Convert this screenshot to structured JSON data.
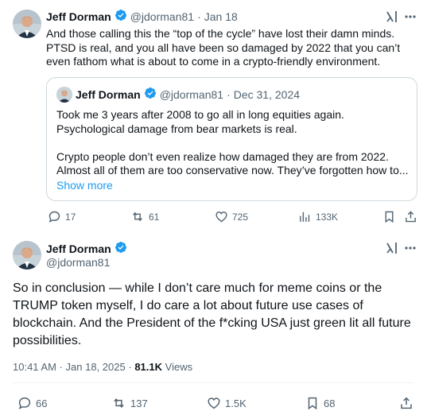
{
  "tweet1": {
    "author_name": "Jeff Dorman",
    "author_handle": "@jdorman81",
    "separator": "·",
    "date": "Jan 18",
    "text_lines": [
      "And those calling this the “top of the cycle” have lost their damn minds.",
      "PTSD is real, and you all have been so damaged by 2022 that you can’t",
      "even fathom what is about to come in a crypto-friendly environment."
    ],
    "quote": {
      "author_name": "Jeff Dorman",
      "author_handle": "@jdorman81",
      "separator": "·",
      "date": "Dec 31, 2024",
      "text_lines": [
        "Took me 3 years after 2008 to go all in long equities again.",
        "Psychological damage from bear markets is real.",
        "",
        "Crypto people don’t even realize how damaged they are from 2022.",
        "Almost all of them are too conservative now. They’ve forgotten how to..."
      ],
      "show_more": "Show more"
    },
    "stats": {
      "replies": "17",
      "reposts": "61",
      "likes": "725",
      "views": "133K"
    }
  },
  "tweet2": {
    "author_name": "Jeff Dorman",
    "author_handle": "@jdorman81",
    "text_lines": [
      "So in conclusion — while I don’t care much for meme coins or the",
      "TRUMP token myself, I do care a lot about future use cases of",
      "blockchain. And the President of the f*cking USA just green lit all future",
      "possibilities."
    ],
    "time": "10:41 AM",
    "separator": "·",
    "date": "Jan 18, 2025",
    "views_count": "81.1K",
    "views_label": "Views",
    "stats": {
      "replies": "66",
      "reposts": "137",
      "likes": "1.5K",
      "bookmarks": "68"
    }
  },
  "colors": {
    "text": "#0f1419",
    "secondary": "#536471",
    "accent": "#1d9bf0",
    "border": "#cfd9de"
  }
}
